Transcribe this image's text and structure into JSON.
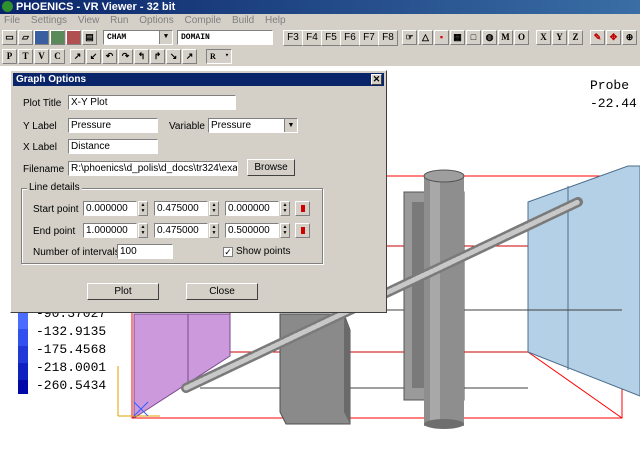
{
  "window": {
    "title": "PHOENICS - VR Viewer - 32 bit"
  },
  "menu": [
    "File",
    "Settings",
    "View",
    "Run",
    "Options",
    "Compile",
    "Build",
    "Help"
  ],
  "toolbar": {
    "variable_combo": "CHAM",
    "object_combo": "DOMAIN",
    "fkeys": [
      "F3",
      "F4",
      "F5",
      "F6",
      "F7",
      "F8"
    ],
    "letter_buttons": [
      "P",
      "T",
      "V",
      "C"
    ],
    "axis_buttons": [
      "M",
      "O",
      "X",
      "Y",
      "Z"
    ],
    "r_combo": "R"
  },
  "viewport": {
    "probe_label": "Probe",
    "probe_value": "-22.44",
    "legend_values": [
      "-90.37027",
      "-132.9135",
      "-175.4568",
      "-218.0001",
      "-260.5434"
    ]
  },
  "dialog": {
    "title": "Graph Options",
    "plot_title_label": "Plot Title",
    "plot_title_value": "X-Y Plot",
    "y_label_label": "Y Label",
    "y_label_value": "Pressure",
    "variable_label": "Variable",
    "variable_value": "Pressure",
    "x_label_label": "X Label",
    "x_label_value": "Distance",
    "filename_label": "Filename",
    "filename_value": "R:\\phoenics\\d_polis\\d_docs\\tr324\\exa",
    "browse_label": "Browse",
    "line_details_label": "Line details",
    "start_point_label": "Start point",
    "start_point": [
      "0.000000",
      "0.475000",
      "0.000000"
    ],
    "end_point_label": "End point",
    "end_point": [
      "1.000000",
      "0.475000",
      "0.500000"
    ],
    "intervals_label": "Number of intervals",
    "intervals_value": "100",
    "show_points_label": "Show points",
    "show_points_checked": true,
    "plot_button": "Plot",
    "close_button": "Close"
  },
  "colors": {
    "title_bar": "#0a246a",
    "face_color": "#d4d0c8",
    "legend_blue": "#0000ff",
    "inlet_purple": "#cc99dd",
    "outlet_blue": "#b3d0e6",
    "domain_edges": "#ff0000"
  }
}
